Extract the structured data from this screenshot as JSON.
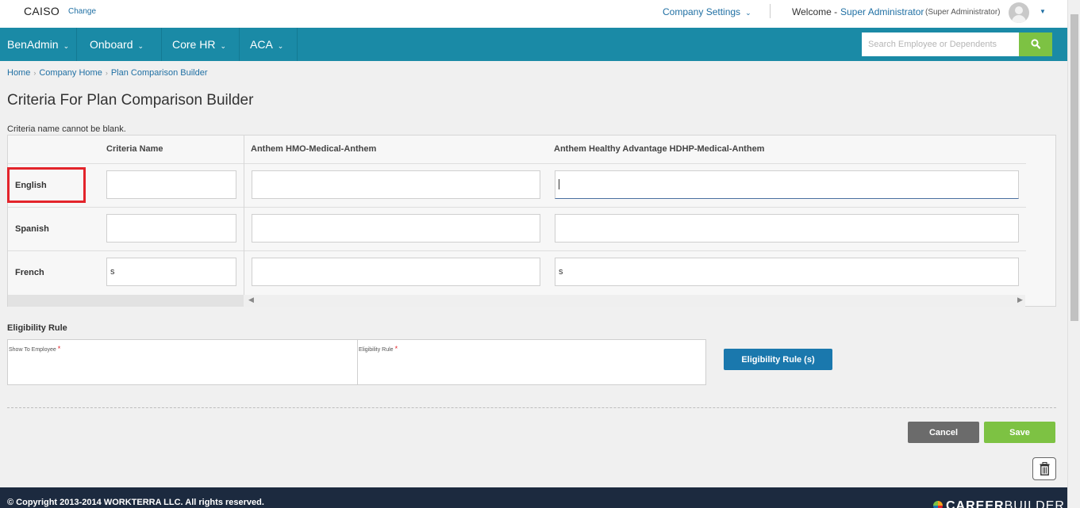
{
  "header": {
    "brand": "CAISO",
    "change_link": "Change",
    "company_settings": "Company Settings",
    "welcome": "Welcome -",
    "user_name": "Super Administrator",
    "user_role": "(Super Administrator)"
  },
  "nav": {
    "items": [
      {
        "label": "BenAdmin"
      },
      {
        "label": "Onboard"
      },
      {
        "label": "Core HR"
      },
      {
        "label": "ACA"
      }
    ],
    "search_placeholder": "Search Employee or Dependents"
  },
  "breadcrumb": [
    "Home",
    "Company Home",
    "Plan Comparison Builder"
  ],
  "page_title": "Criteria For Plan Comparison Builder",
  "error_message": "Criteria name cannot be blank.",
  "criteria_table": {
    "columns": [
      "Criteria Name",
      "Anthem HMO-Medical-Anthem",
      "Anthem Healthy Advantage HDHP-Medical-Anthem"
    ],
    "rows": [
      {
        "language": "English",
        "criteria_name": "",
        "plan1": "",
        "plan2": ""
      },
      {
        "language": "Spanish",
        "criteria_name": "",
        "plan1": "",
        "plan2": ""
      },
      {
        "language": "French",
        "criteria_name": "s",
        "plan1": "",
        "plan2": "s"
      }
    ]
  },
  "eligibility": {
    "title": "Eligibility Rule",
    "show_to_employee_label": "Show To Employee",
    "eligibility_rule_label": "Eligibility Rule",
    "required_mark": "*",
    "button_label": "Eligibility Rule (s)"
  },
  "actions": {
    "cancel_label": "Cancel",
    "save_label": "Save"
  },
  "footer": {
    "copyright": "© Copyright 2013-2014 WORKTERRA LLC. All rights reserved.",
    "logo_bold": "CAREER",
    "logo_light": "BUILDER"
  },
  "colors": {
    "nav_bg": "#1a8aa6",
    "accent_green": "#7dc243",
    "link_blue": "#1f6fa3",
    "button_blue": "#1a78ad",
    "highlight_red": "#e3242b",
    "footer_bg": "#1c2a3f"
  }
}
